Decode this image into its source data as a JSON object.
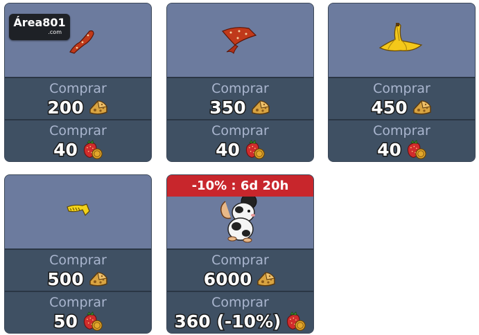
{
  "logo": {
    "text": "Área801",
    "sub": ".com"
  },
  "items": [
    {
      "badge": "",
      "cheese_label": "Comprar",
      "cheese_price": "200",
      "straw_label": "Comprar",
      "straw_price": "40"
    },
    {
      "badge": "",
      "cheese_label": "Comprar",
      "cheese_price": "350",
      "straw_label": "Comprar",
      "straw_price": "40"
    },
    {
      "badge": "",
      "cheese_label": "Comprar",
      "cheese_price": "450",
      "straw_label": "Comprar",
      "straw_price": "40"
    },
    {
      "badge": "",
      "cheese_label": "Comprar",
      "cheese_price": "500",
      "straw_label": "Comprar",
      "straw_price": "50"
    },
    {
      "badge": "-10% : 6d 20h",
      "cheese_label": "Comprar",
      "cheese_price": "6000",
      "straw_label": "Comprar",
      "straw_price": "360 (-10%)"
    }
  ],
  "colors": {
    "preview_bg": "#6c7b9e",
    "buy_bg": "#3f5063",
    "badge_bg": "#c8262c"
  },
  "icons": {
    "cheese": "cheese-icon",
    "strawberry": "strawberry-coin-icon"
  }
}
